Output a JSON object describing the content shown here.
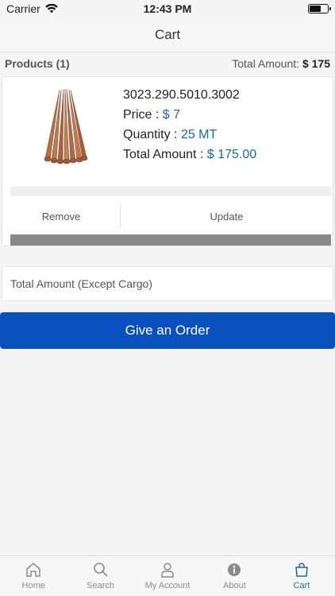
{
  "status": {
    "carrier": "Carrier",
    "time": "12:43 PM"
  },
  "nav": {
    "title": "Cart"
  },
  "summary": {
    "products_label": "Products (1)",
    "total_label": "Total Amount:",
    "total_value": "$ 175"
  },
  "product": {
    "code": "3023.290.5010.3002",
    "price_label": "Price :",
    "price_value": "$ 7",
    "quantity_label": "Quantity :",
    "quantity_value": "25 MT",
    "total_label": "Total Amount :",
    "total_value": "$ 175.00",
    "remove_label": "Remove",
    "update_label": "Update"
  },
  "total_field": {
    "placeholder": "Total Amount (Except Cargo)"
  },
  "order_button": {
    "label": "Give an Order"
  },
  "tabs": [
    {
      "label": "Home",
      "icon": "home-icon"
    },
    {
      "label": "Search",
      "icon": "search-icon"
    },
    {
      "label": "My Account",
      "icon": "account-icon"
    },
    {
      "label": "About",
      "icon": "info-icon"
    },
    {
      "label": "Cart",
      "icon": "cart-icon",
      "active": true
    }
  ],
  "colors": {
    "accent": "#1a66a8",
    "button": "#0a4fbe"
  }
}
